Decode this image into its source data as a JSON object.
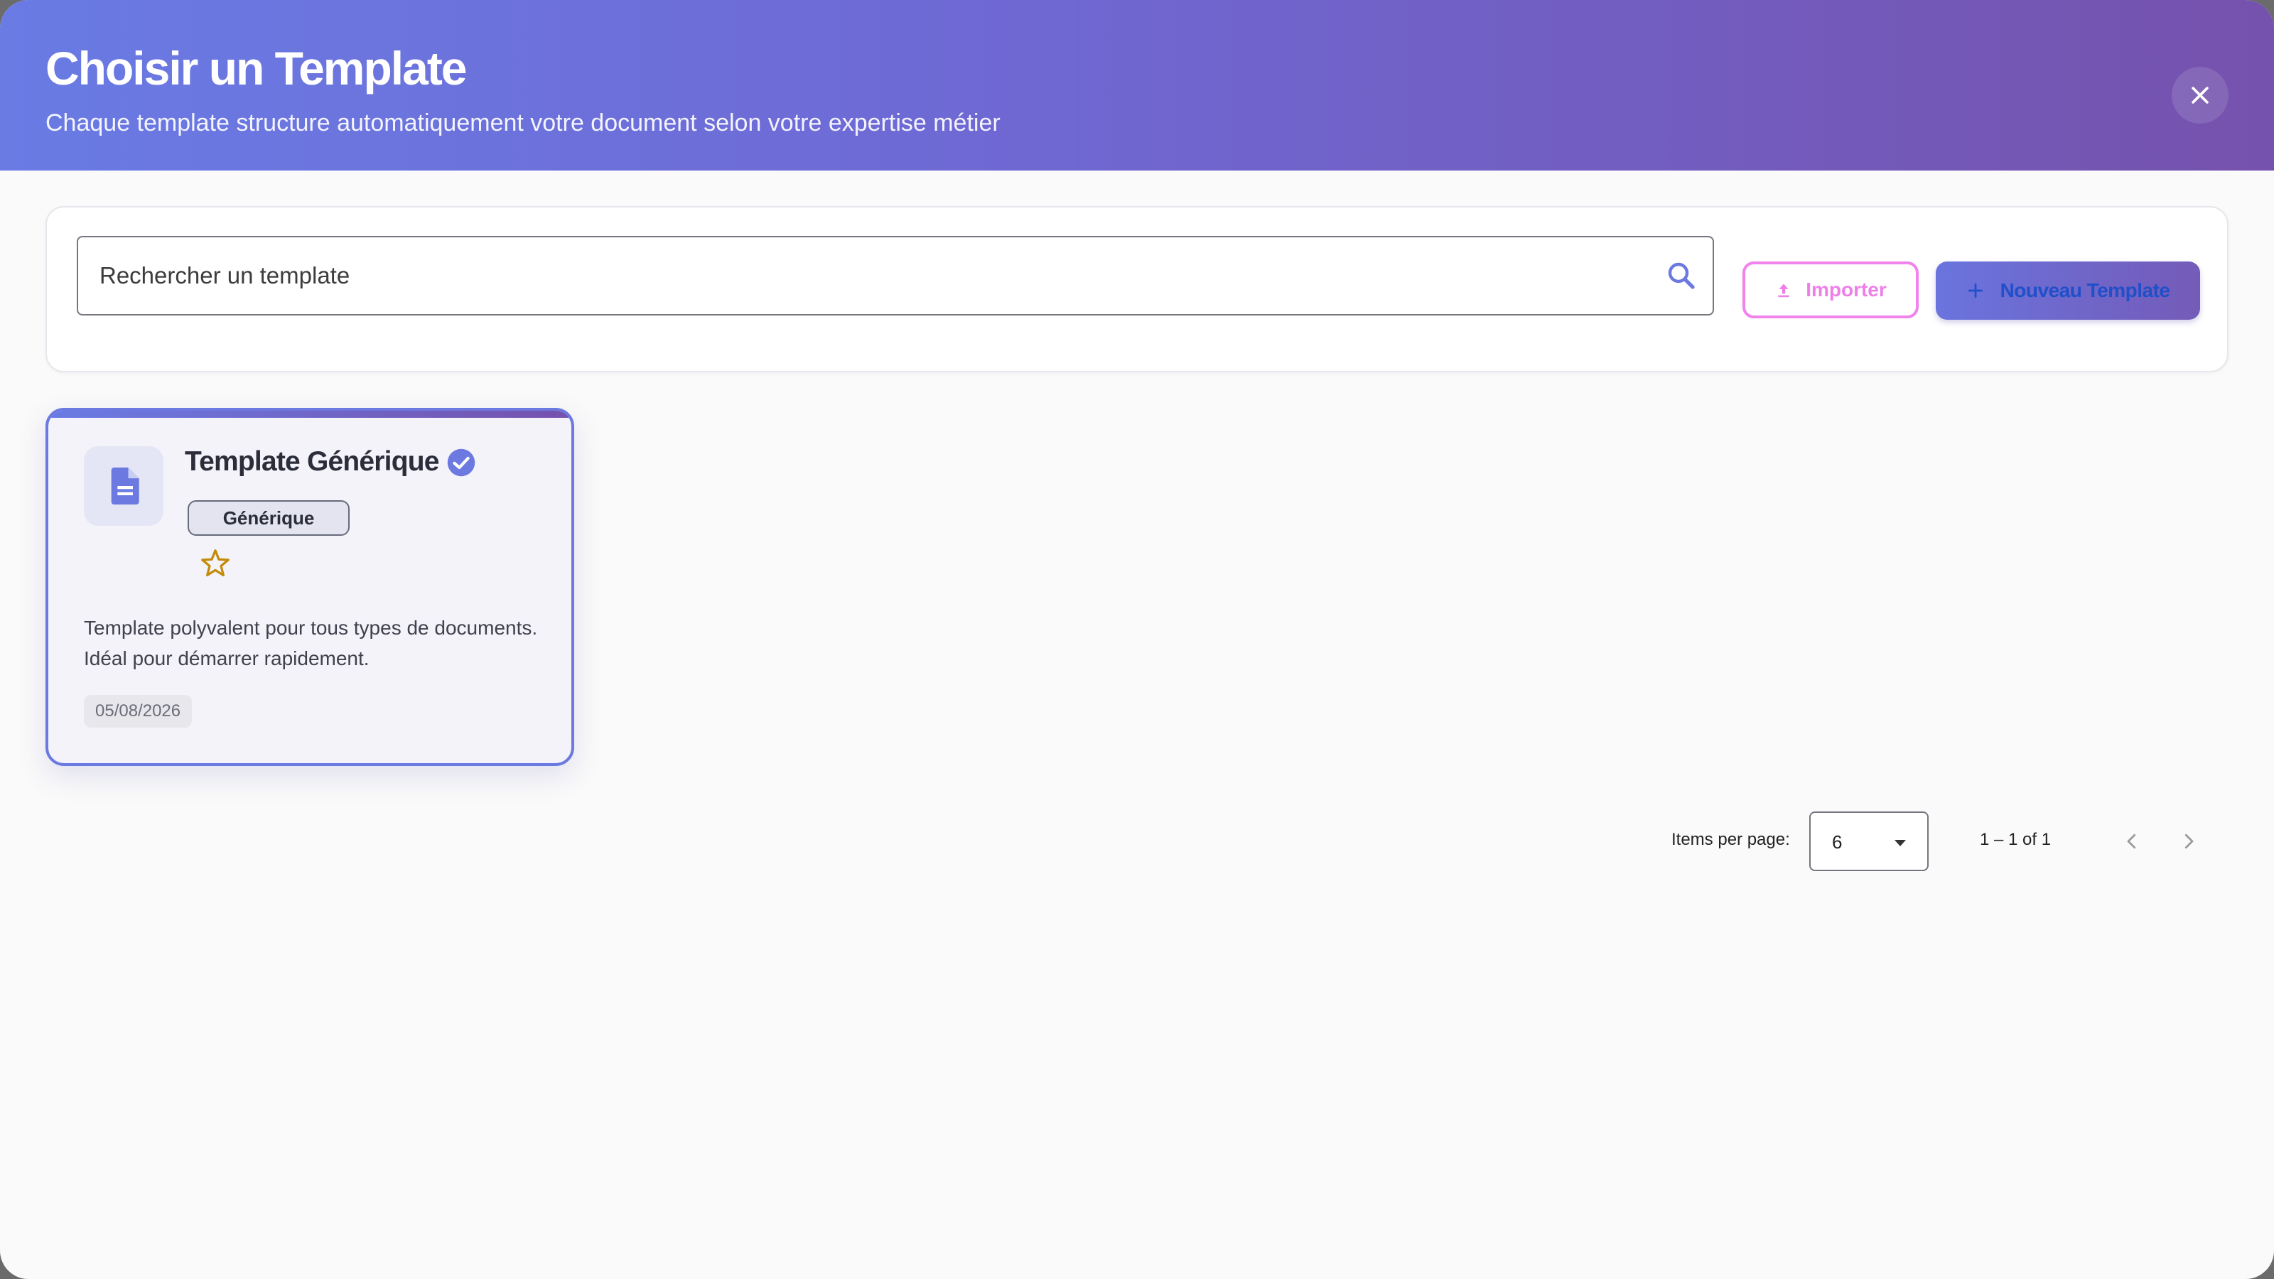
{
  "header": {
    "title": "Choisir un Template",
    "subtitle": "Chaque template structure automatiquement votre document selon votre expertise métier",
    "close_icon": "close-icon",
    "gradient_start": "#6a7be4",
    "gradient_end": "#7552ad"
  },
  "toolbar": {
    "search_placeholder": "Rechercher un template",
    "search_value": "",
    "search_icon": "search-icon",
    "import_label": "Importer",
    "import_icon": "upload-icon",
    "import_color": "#ee7fe8",
    "new_label": "Nouveau Template",
    "new_icon": "plus-icon"
  },
  "templates": [
    {
      "title": "Template Générique",
      "verified": true,
      "category": "Générique",
      "favorite": false,
      "description": "Template polyvalent pour tous types de documents. Idéal pour démarrer rapidement.",
      "date": "05/08/2026",
      "icon": "document-icon",
      "selected": true
    }
  ],
  "paginator": {
    "items_per_page_label": "Items per page:",
    "page_size": "6",
    "range_label": "1 – 1 of 1",
    "prev_icon": "chevron-left-icon",
    "next_icon": "chevron-right-icon"
  },
  "colors": {
    "accent": "#6b79e0",
    "background": "#fafafa",
    "favorite_star": "#c58a0a"
  }
}
